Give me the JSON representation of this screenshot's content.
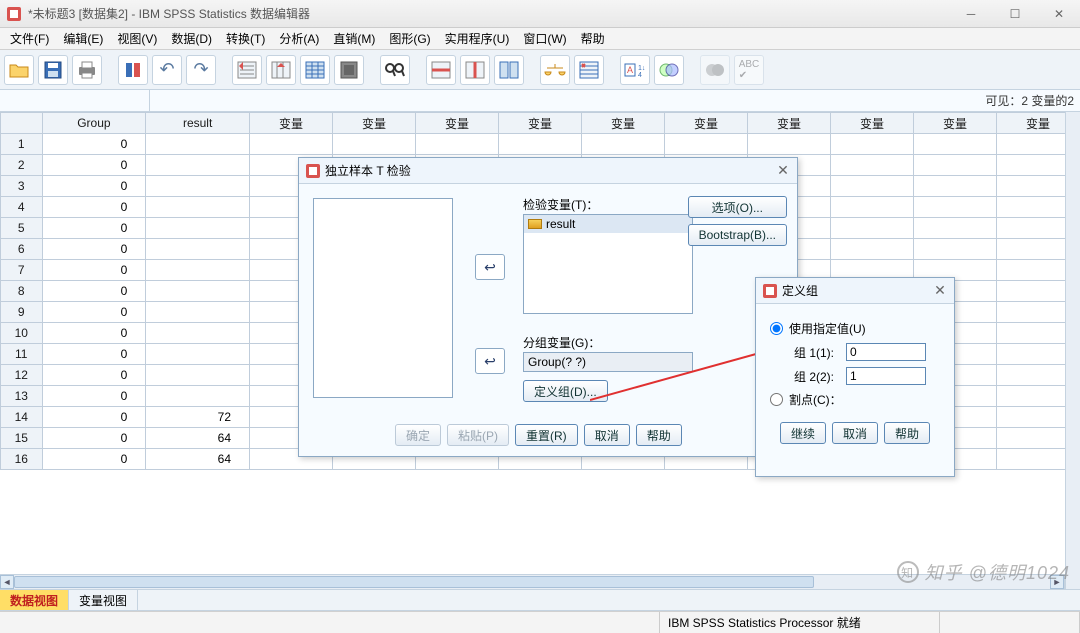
{
  "window": {
    "title": "*未标题3 [数据集2] - IBM SPSS Statistics 数据编辑器"
  },
  "menu": {
    "file": "文件(F)",
    "edit": "编辑(E)",
    "view": "视图(V)",
    "data": "数据(D)",
    "transform": "转换(T)",
    "analyze": "分析(A)",
    "direct": "直销(M)",
    "graphs": "图形(G)",
    "utilities": "实用程序(U)",
    "window": "窗口(W)",
    "help": "帮助"
  },
  "infobar": {
    "visible": "可见：2 变量的2"
  },
  "columns": [
    "Group",
    "result",
    "变量",
    "变量",
    "变量",
    "变量",
    "变量",
    "变量",
    "变量",
    "变量",
    "变量",
    "变量"
  ],
  "rows": [
    {
      "n": 1,
      "group": 0,
      "result": ""
    },
    {
      "n": 2,
      "group": 0,
      "result": ""
    },
    {
      "n": 3,
      "group": 0,
      "result": ""
    },
    {
      "n": 4,
      "group": 0,
      "result": ""
    },
    {
      "n": 5,
      "group": 0,
      "result": ""
    },
    {
      "n": 6,
      "group": 0,
      "result": ""
    },
    {
      "n": 7,
      "group": 0,
      "result": ""
    },
    {
      "n": 8,
      "group": 0,
      "result": ""
    },
    {
      "n": 9,
      "group": 0,
      "result": ""
    },
    {
      "n": 10,
      "group": 0,
      "result": ""
    },
    {
      "n": 11,
      "group": 0,
      "result": ""
    },
    {
      "n": 12,
      "group": 0,
      "result": ""
    },
    {
      "n": 13,
      "group": 0,
      "result": ""
    },
    {
      "n": 14,
      "group": 0,
      "result": "72"
    },
    {
      "n": 15,
      "group": 0,
      "result": "64"
    },
    {
      "n": 16,
      "group": 0,
      "result": "64"
    }
  ],
  "tabs": {
    "data": "数据视图",
    "variable": "变量视图"
  },
  "status": {
    "processor": "IBM SPSS Statistics Processor 就绪"
  },
  "dlg1": {
    "title": "独立样本 T 检验",
    "test_label": "检验变量(T)：",
    "test_item": "result",
    "group_label": "分组变量(G)：",
    "group_value": "Group(? ?)",
    "define_groups": "定义组(D)...",
    "options": "选项(O)...",
    "bootstrap": "Bootstrap(B)...",
    "ok": "确定",
    "paste": "粘贴(P)",
    "reset": "重置(R)",
    "cancel": "取消",
    "help": "帮助"
  },
  "dlg2": {
    "title": "定义组",
    "use_specified": "使用指定值(U)",
    "group1": "组 1(1):",
    "group1_val": "0",
    "group2": "组 2(2):",
    "group2_val": "1",
    "cutpoint": "割点(C)：",
    "continue": "继续",
    "cancel": "取消",
    "help": "帮助"
  },
  "watermark": "知乎 @德明1024"
}
